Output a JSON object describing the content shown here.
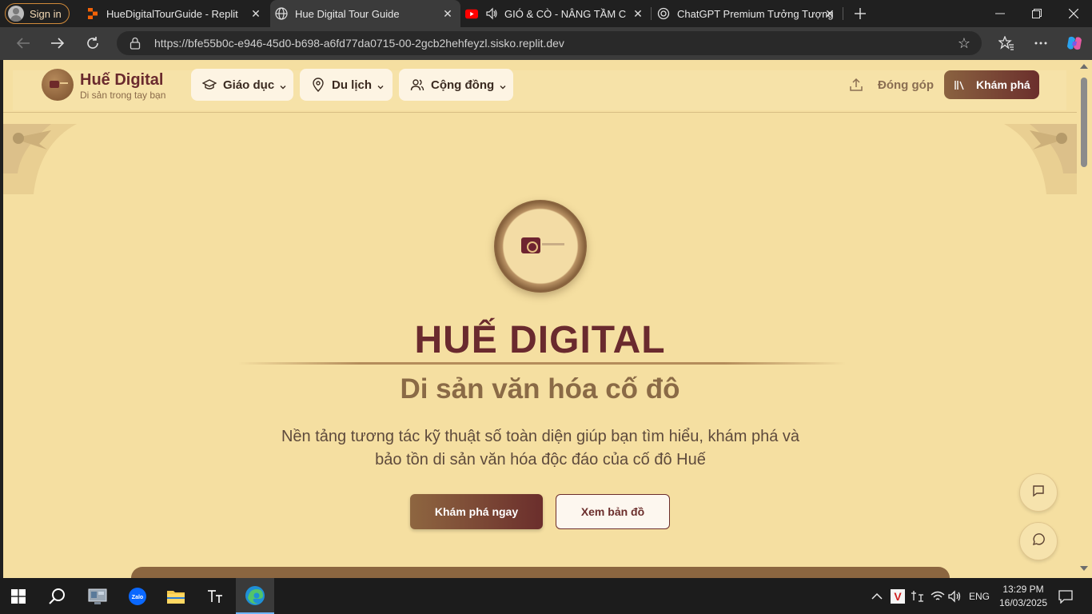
{
  "browser": {
    "signin_label": "Sign in",
    "tabs": [
      {
        "title": "HueDigitalTourGuide - Replit"
      },
      {
        "title": "Hue Digital Tour Guide"
      },
      {
        "title": "GIÓ & CÒ - NÂNG TẦM CUỘ"
      },
      {
        "title": "ChatGPT Premium Tưởng Tượng"
      }
    ],
    "url": "https://bfe55b0c-e946-45d0-b698-a6fd77da0715-00-2gcb2hehfeyzl.sisko.replit.dev"
  },
  "site": {
    "brand_title": "Huế Digital",
    "brand_subtitle": "Di sản trong tay bạn",
    "menu": [
      {
        "label": "Giáo dục",
        "icon": "graduation-cap-icon"
      },
      {
        "label": "Du lịch",
        "icon": "map-pin-icon"
      },
      {
        "label": "Cộng đồng",
        "icon": "users-icon"
      }
    ],
    "contribute_label": "Đóng góp",
    "explore_label": "Khám phá"
  },
  "hero": {
    "title": "HUẾ DIGITAL",
    "subtitle": "Di sản văn hóa cố đô",
    "description_line1": "Nền tảng tương tác kỹ thuật số toàn diện giúp bạn tìm hiểu, khám phá và",
    "description_line2": "bảo tồn di sản văn hóa độc đáo của cố đô Huế",
    "primary_cta": "Khám phá ngay",
    "secondary_cta": "Xem bản đồ"
  },
  "taskbar": {
    "language": "ENG",
    "time": "13:29 PM",
    "date": "16/03/2025"
  },
  "colors": {
    "page_bg": "#f5dfa1",
    "brand_maroon": "#6a2a2e",
    "brand_brown": "#8a6a46"
  }
}
